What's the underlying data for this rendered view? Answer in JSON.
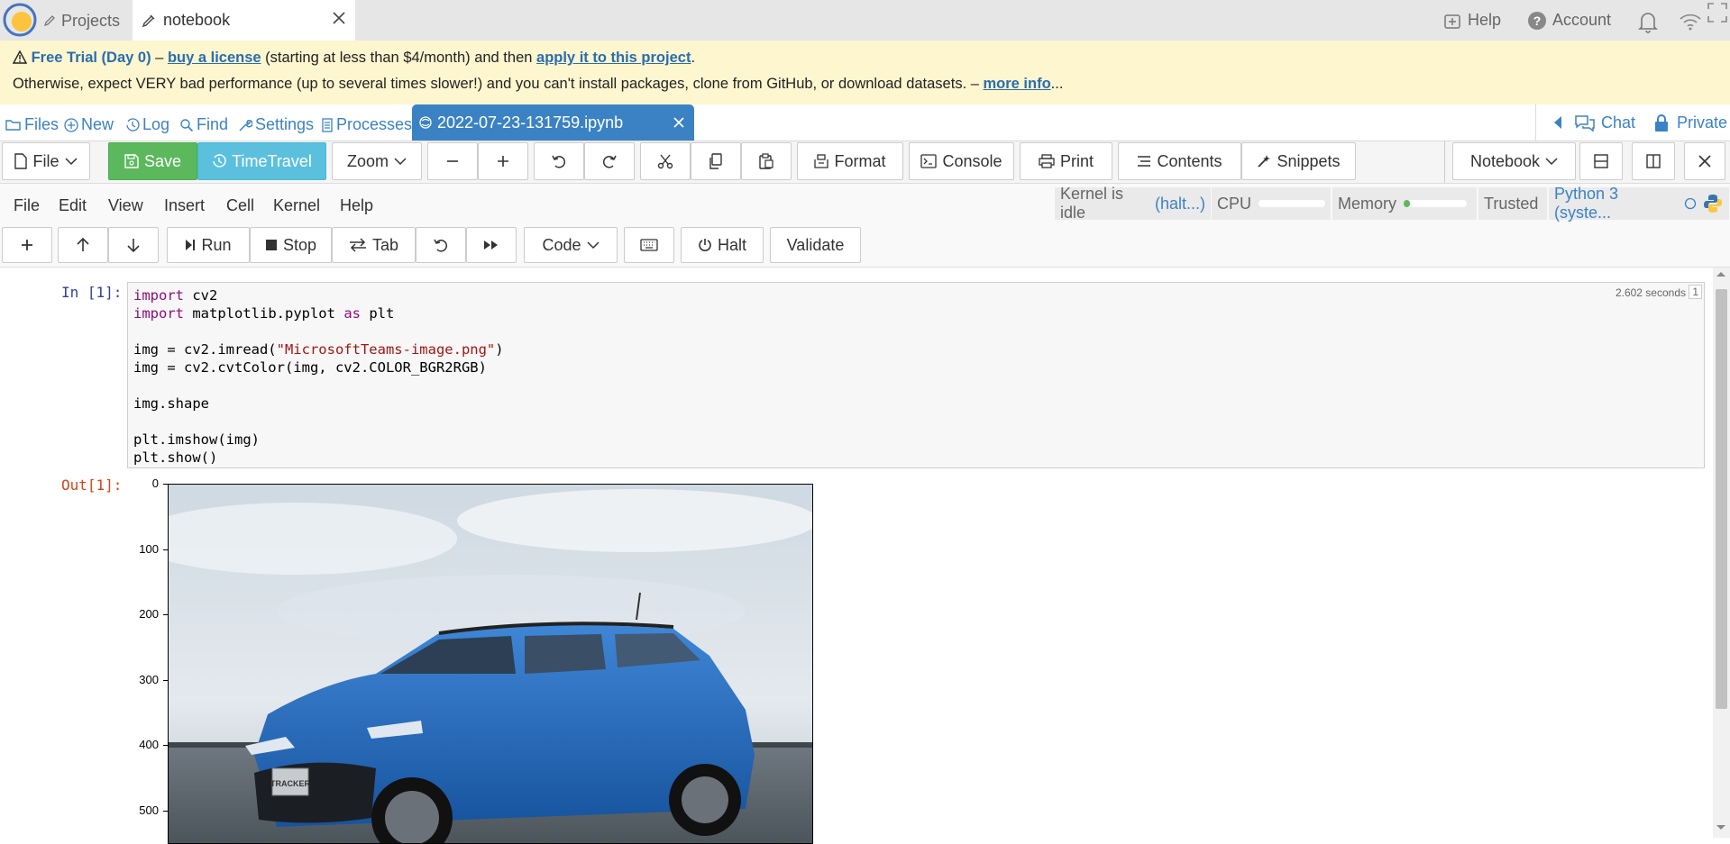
{
  "topbar": {
    "tabs": [
      {
        "label": "Projects",
        "icon": "pencil-icon"
      },
      {
        "label": "notebook",
        "icon": "edit-icon"
      }
    ],
    "help": "Help",
    "account": "Account"
  },
  "banner": {
    "free_trial": "Free Trial (Day 0)",
    "dash1": " – ",
    "buy_license": "buy a license",
    "line1_mid": " (starting at less than $4/month) and then ",
    "apply_link": "apply it to this project",
    "line1_end": ".",
    "line2": "Otherwise, expect VERY bad performance (up to several times slower!) and you can't install packages, clone from GitHub, or download datasets. – ",
    "more_info": "more info",
    "ellipsis": "..."
  },
  "project_nav": {
    "items": [
      "Files",
      "New",
      "Log",
      "Find",
      "Settings",
      "Processes"
    ],
    "open_file": "2022-07-23-131759.ipynb",
    "chat": "Chat",
    "private": "Private"
  },
  "toolbar": {
    "file": "File",
    "save": "Save",
    "timetravel": "TimeTravel",
    "zoom": "Zoom",
    "format": "Format",
    "console": "Console",
    "print": "Print",
    "contents": "Contents",
    "snippets": "Snippets",
    "notebook": "Notebook"
  },
  "menubar": {
    "items": [
      "File",
      "Edit",
      "View",
      "Insert",
      "Cell",
      "Kernel",
      "Help"
    ],
    "kernel_idle": "Kernel is idle",
    "halt": "(halt...)",
    "cpu": "CPU",
    "memory": "Memory",
    "trusted": "Trusted",
    "python": "Python 3 (syste...",
    "memory_usage": 0.1
  },
  "toolbar2": {
    "run": "Run",
    "stop": "Stop",
    "tab": "Tab",
    "cell_type": "Code",
    "halt": "Halt",
    "validate": "Validate"
  },
  "cell": {
    "in_prompt": "In [1]:",
    "out_prompt": "Out[1]:",
    "exec_time": "2.602 seconds",
    "exec_count": "1",
    "code_lines": [
      "import cv2",
      "import matplotlib.pyplot as plt",
      "",
      "img = cv2.imread(\"MicrosoftTeams-image.png\")",
      "img = cv2.cvtColor(img, cv2.COLOR_BGR2RGB)",
      "",
      "img.shape",
      "",
      "plt.imshow(img)",
      "plt.show()"
    ]
  },
  "output_plot": {
    "y_ticks": [
      "0",
      "100",
      "200",
      "300",
      "400",
      "500"
    ],
    "badge_text": "TRACKER"
  }
}
